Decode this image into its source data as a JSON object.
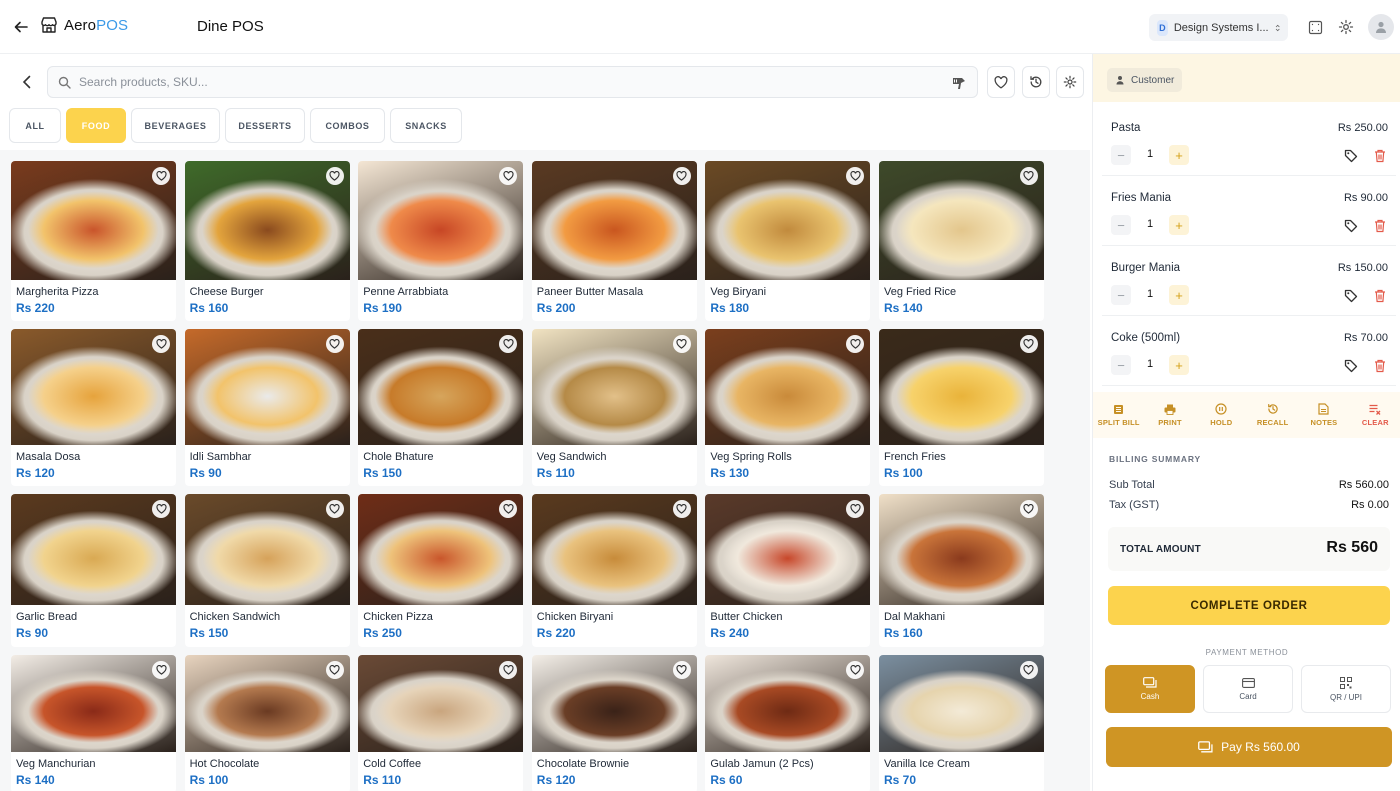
{
  "header": {
    "brand_prefix": "Aero",
    "brand_suffix": "POS",
    "page_title": "Dine POS",
    "workspace_initial": "D",
    "workspace_name": "Design Systems I..."
  },
  "search": {
    "placeholder": "Search products, SKU..."
  },
  "categories": [
    "ALL",
    "FOOD",
    "BEVERAGES",
    "DESSERTS",
    "COMBOS",
    "SNACKS"
  ],
  "active_category": "FOOD",
  "products": [
    {
      "name": "Margherita Pizza",
      "price": "Rs 220"
    },
    {
      "name": "Cheese Burger",
      "price": "Rs 160"
    },
    {
      "name": "Penne Arrabbiata",
      "price": "Rs 190"
    },
    {
      "name": "Paneer Butter Masala",
      "price": "Rs 200"
    },
    {
      "name": "Veg Biryani",
      "price": "Rs 180"
    },
    {
      "name": "Veg Fried Rice",
      "price": "Rs 140"
    },
    {
      "name": "Masala Dosa",
      "price": "Rs 120"
    },
    {
      "name": "Idli Sambhar",
      "price": "Rs 90"
    },
    {
      "name": "Chole Bhature",
      "price": "Rs 150"
    },
    {
      "name": "Veg Sandwich",
      "price": "Rs 110"
    },
    {
      "name": "Veg Spring Rolls",
      "price": "Rs 130"
    },
    {
      "name": "French Fries",
      "price": "Rs 100"
    },
    {
      "name": "Garlic Bread",
      "price": "Rs 90"
    },
    {
      "name": "Chicken Sandwich",
      "price": "Rs 150"
    },
    {
      "name": "Chicken Pizza",
      "price": "Rs 250"
    },
    {
      "name": "Chicken Biryani",
      "price": "Rs 220"
    },
    {
      "name": "Butter Chicken",
      "price": "Rs 240"
    },
    {
      "name": "Dal Makhani",
      "price": "Rs 160"
    },
    {
      "name": "Veg Manchurian",
      "price": "Rs 140"
    },
    {
      "name": "Hot Chocolate",
      "price": "Rs 100"
    },
    {
      "name": "Cold Coffee",
      "price": "Rs 110"
    },
    {
      "name": "Chocolate Brownie",
      "price": "Rs 120"
    },
    {
      "name": "Gulab Jamun (2 Pcs)",
      "price": "Rs 60"
    },
    {
      "name": "Vanilla Ice Cream",
      "price": "Rs 70"
    }
  ],
  "cart": {
    "customer_label": "Customer",
    "items": [
      {
        "name": "Pasta",
        "price": "Rs 250.00",
        "qty": "1"
      },
      {
        "name": "Fries Mania",
        "price": "Rs 90.00",
        "qty": "1"
      },
      {
        "name": "Burger Mania",
        "price": "Rs 150.00",
        "qty": "1"
      },
      {
        "name": "Coke (500ml)",
        "price": "Rs 70.00",
        "qty": "1"
      }
    ],
    "actions": [
      "SPLIT BILL",
      "PRINT",
      "HOLD",
      "RECALL",
      "NOTES",
      "CLEAR"
    ]
  },
  "billing": {
    "title": "BILLING SUMMARY",
    "subtotal_label": "Sub Total",
    "subtotal_value": "Rs 560.00",
    "tax_label": "Tax (GST)",
    "tax_value": "Rs 0.00",
    "total_label": "TOTAL AMOUNT",
    "total_value": "Rs 560",
    "complete_label": "COMPLETE ORDER"
  },
  "payment": {
    "title": "PAYMENT METHOD",
    "methods": [
      "Cash",
      "Card",
      "QR / UPI"
    ],
    "selected": "Cash",
    "pay_label": "Pay Rs 560.00"
  },
  "colors": {
    "accent_yellow": "#fcd34d",
    "accent_gold": "#cf9524",
    "price_blue": "#1d6fc4",
    "danger": "#e35a4a"
  }
}
